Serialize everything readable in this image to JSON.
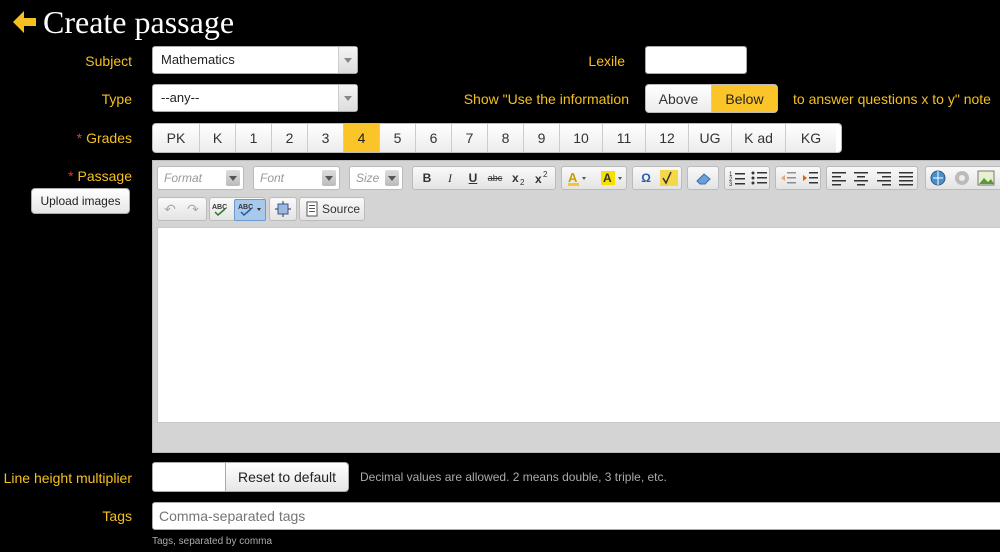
{
  "header": {
    "title": "Create passage"
  },
  "subject": {
    "label": "Subject",
    "value": "Mathematics"
  },
  "type": {
    "label": "Type",
    "value": "--any--"
  },
  "lexile": {
    "label": "Lexile",
    "value": ""
  },
  "use_info": {
    "label": "Show \"Use the information",
    "options": [
      "Above",
      "Below"
    ],
    "selected": "Below",
    "suffix": "to answer questions x to y\" note"
  },
  "grades": {
    "label": "Grades",
    "options": [
      "PK",
      "K",
      "1",
      "2",
      "3",
      "4",
      "5",
      "6",
      "7",
      "8",
      "9",
      "10",
      "11",
      "12",
      "UG",
      "K ad",
      "KG"
    ],
    "selected": "4"
  },
  "passage": {
    "label": "Passage",
    "upload_label": "Upload images",
    "toolbar": {
      "format_placeholder": "Format",
      "font_placeholder": "Font",
      "size_placeholder": "Size",
      "bold": "B",
      "italic": "I",
      "underline": "U",
      "strike": "abc",
      "source_label": "Source"
    }
  },
  "line_height": {
    "label": "Line height multiplier",
    "value": "",
    "reset_label": "Reset to default",
    "hint": "Decimal values are allowed. 2 means double, 3 triple, etc."
  },
  "tags": {
    "label": "Tags",
    "placeholder": "Comma-separated tags",
    "hint": "Tags, separated by comma"
  },
  "colors": {
    "accent": "#f5c01f",
    "active": "#fbc52a",
    "required": "#ee3333"
  }
}
